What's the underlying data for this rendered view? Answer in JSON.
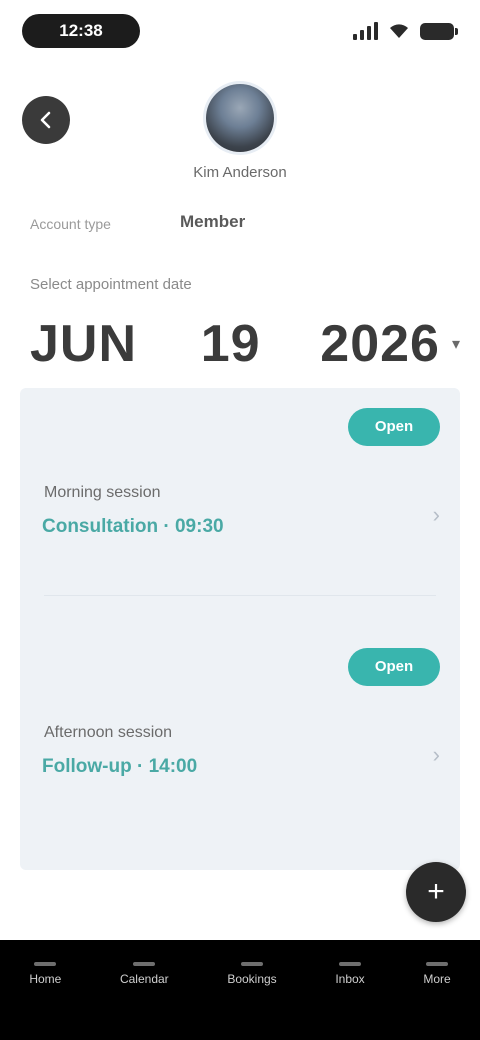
{
  "status": {
    "time": "12:38"
  },
  "profile": {
    "name": "Kim Anderson",
    "meta_label": "Account type",
    "meta_value": "Member"
  },
  "date_section": {
    "label": "Select appointment date",
    "month": "JUN",
    "day": "19",
    "year": "2026"
  },
  "cards": [
    {
      "badge": "Open",
      "title": "Morning session",
      "subtitle": "Consultation · 09:30"
    },
    {
      "badge": "Open",
      "title": "Afternoon session",
      "subtitle": "Follow-up · 14:00"
    }
  ],
  "nav": {
    "items": [
      {
        "label": "Home"
      },
      {
        "label": "Calendar"
      },
      {
        "label": "Bookings"
      },
      {
        "label": "Inbox"
      },
      {
        "label": "More"
      }
    ]
  },
  "colors": {
    "accent": "#39b5ae",
    "accent_text": "#4aa9a5",
    "panel": "#eef2f6",
    "nav_bar": "#000000"
  },
  "icons": {
    "back": "back-arrow-icon",
    "fab": "plus-icon",
    "chevron": "chevron-right-icon"
  }
}
